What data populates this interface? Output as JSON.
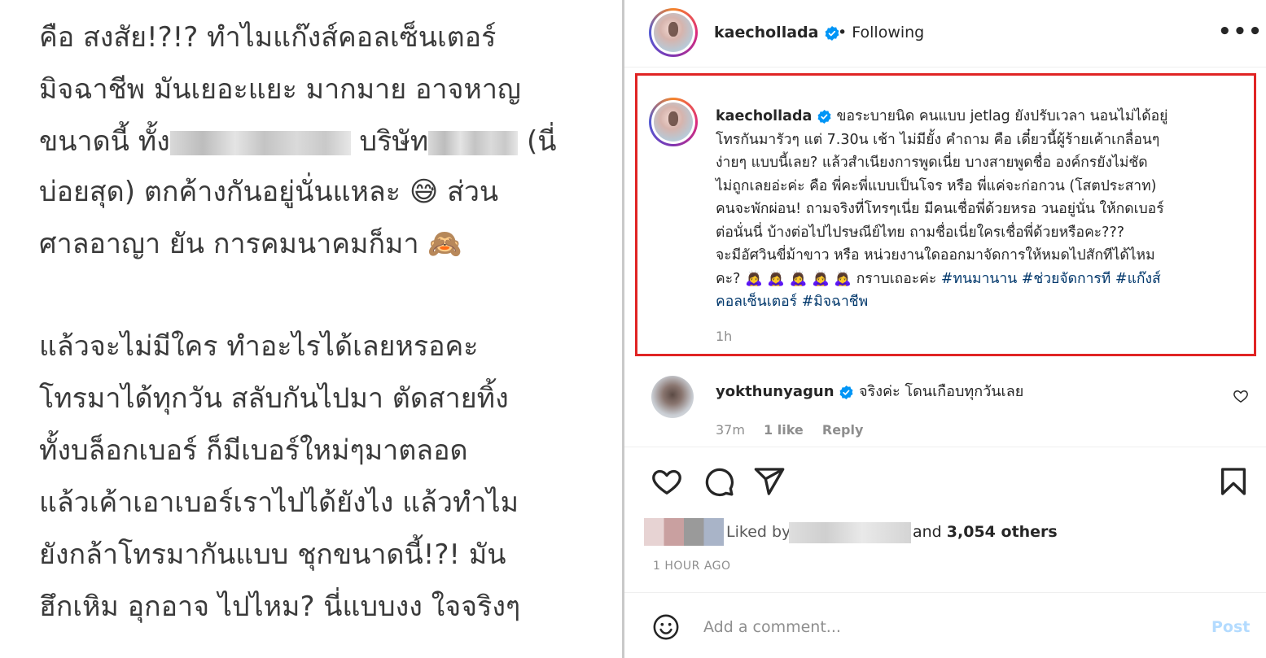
{
  "left_panel": {
    "lines": [
      "คือ สงสัย!?!? ทำไมแก๊งส์คอลเซ็นเตอร์",
      "มิจฉาชีพ มันเยอะแยะ มากมาย อาจหาญ",
      "บริษัท",
      "(นี่",
      "ขนาดนี้ ทั้ง",
      "บ่อยสุด) ตกค้างกันอยู่นั่นแหละ 😅 ส่วน",
      "ศาลอาญา ยัน การคมนาคมก็มา 🙈",
      "แล้วจะไม่มีใคร ทำอะไรได้เลยหรอคะ",
      "โทรมาได้ทุกวัน สลับกันไปมา ตัดสายทิ้ง",
      "ทั้งบล็อกเบอร์ ก็มีเบอร์ใหม่ๆมาตลอด",
      "แล้วเค้าเอาเบอร์เราไปได้ยังไง แล้วทำไม",
      "ยังกล้าโทรมากันแบบ ชุกขนาดนี้!?! มัน",
      "ฮึกเหิม อุกอาจ ไปไหม? นี่แบบงง ใจจริงๆ"
    ]
  },
  "header": {
    "username": "kaechollada",
    "bullet": "•",
    "follow_status": "Following",
    "more": "•••"
  },
  "caption": {
    "username": "kaechollada",
    "text_lines": [
      "ขอระบายนิด คนแบบ jetlag ยังปรับเวลา นอนไม่ได้อยู่",
      "โทรกันมารัวๆ แต่ 7.30น เช้า ไม่มียั้ง คำถาม คือ เดี๋ยวนี้ผู้ร้ายเค้าเกลื่อนๆ",
      "ง่ายๆ แบบนี้เลย? แล้วสำเนียงการพูดเนี่ย บางสายพูดชื่อ องค์กรยังไม่ชัด",
      "ไม่ถูกเลยอ่ะค่ะ คือ พี่คะพี่แบบเป็นโจร หรือ พี่แค่จะก่อกวน (โสตประสาท)",
      "คนจะพักผ่อน! ถามจริงที่โทรๆเนี่ย มีคนเชื่อพี่ด้วยหรอ วนอยู่นั่น ให้กดเบอร์",
      "ต่อนั่นนี่ บ้างต่อไปไปรษณีย์ไทย ถามชื่อเนี่ยใครเชื่อพี่ด้วยหรือคะ???",
      "จะมีอัศวินขี่ม้าขาว หรือ หน่วยงานใดออกมาจัดการให้หมดไปสักทีได้ไหม"
    ],
    "last_line_prefix": "คะ?",
    "emojis": "🙇‍♀️ 🙇‍♀️ 🙇‍♀️ 🙇‍♀️ 🙇‍♀️",
    "last_line_text": "กราบเถอะค่ะ",
    "hashtags": [
      "#ทนมานาน",
      "#ช่วยจัดการที",
      "#แก๊งส์",
      "คอลเซ็นเตอร์",
      "#มิจฉาชีพ"
    ],
    "time": "1h"
  },
  "comment": {
    "username": "yokthunyagun",
    "text": "จริงค่ะ โดนเกือบทุกวันเลย",
    "time": "37m",
    "likes": "1 like",
    "reply": "Reply"
  },
  "likes": {
    "prefix": "Liked by",
    "suffix": "and",
    "count": "3,054 others",
    "ago": "1 HOUR AGO"
  },
  "add_comment": {
    "placeholder": "Add a comment...",
    "post": "Post"
  },
  "colors": {
    "verified": "#0095f6",
    "highlight_box": "#e02424",
    "hashtag": "#00376b",
    "post_disabled": "#b3dbff"
  },
  "icons": [
    "heart-icon",
    "comment-icon",
    "share-icon",
    "bookmark-icon",
    "emoji-icon",
    "verified-icon",
    "more-icon"
  ]
}
